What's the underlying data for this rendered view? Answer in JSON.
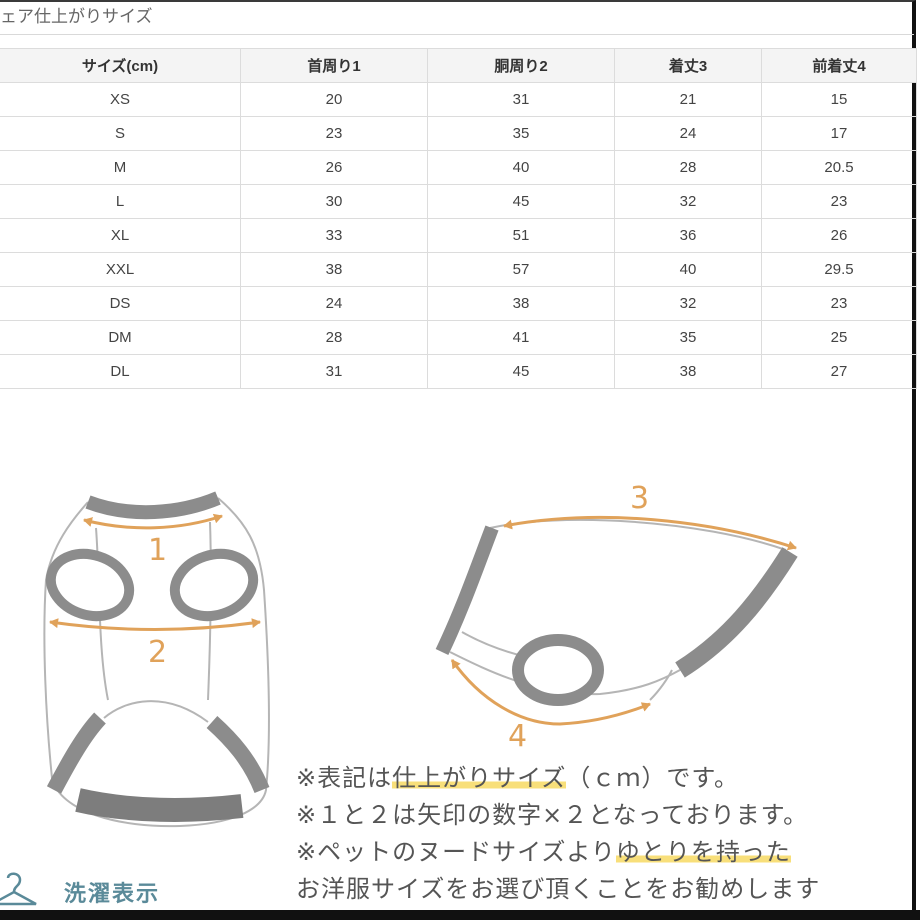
{
  "header": {
    "title": "ェア仕上がりサイズ"
  },
  "table": {
    "columns": [
      "サイズ(cm)",
      "首周り1",
      "胴周り2",
      "着丈3",
      "前着丈4"
    ],
    "rows": [
      [
        "XS",
        "20",
        "31",
        "21",
        "15"
      ],
      [
        "S",
        "23",
        "35",
        "24",
        "17"
      ],
      [
        "M",
        "26",
        "40",
        "28",
        "20.5"
      ],
      [
        "L",
        "30",
        "45",
        "32",
        "23"
      ],
      [
        "XL",
        "33",
        "51",
        "36",
        "26"
      ],
      [
        "XXL",
        "38",
        "57",
        "40",
        "29.5"
      ],
      [
        "DS",
        "24",
        "38",
        "32",
        "23"
      ],
      [
        "DM",
        "28",
        "41",
        "35",
        "25"
      ],
      [
        "DL",
        "31",
        "45",
        "38",
        "27"
      ]
    ]
  },
  "diagram": {
    "labels": {
      "one": "1",
      "two": "2",
      "three": "3",
      "four": "4"
    },
    "colors": {
      "arrow": "#e0a25a",
      "trim": "#8c8c8c",
      "outline": "#b5b5b5"
    }
  },
  "notes": {
    "line1": {
      "prefix": "※表記は",
      "highlight": "仕上がりサイズ",
      "suffix": "（ｃｍ）です。"
    },
    "line2": {
      "text": "※１と２は矢印の数字×２となっております。"
    },
    "line3": {
      "prefix": "※ペットのヌードサイズより",
      "highlight": "ゆとりを持った",
      "suffix": ""
    },
    "line4": {
      "text": "お洋服サイズをお選び頂くことをお勧めします"
    }
  },
  "laundry": {
    "label": "洗濯表示",
    "icon": "hanger-icon"
  }
}
